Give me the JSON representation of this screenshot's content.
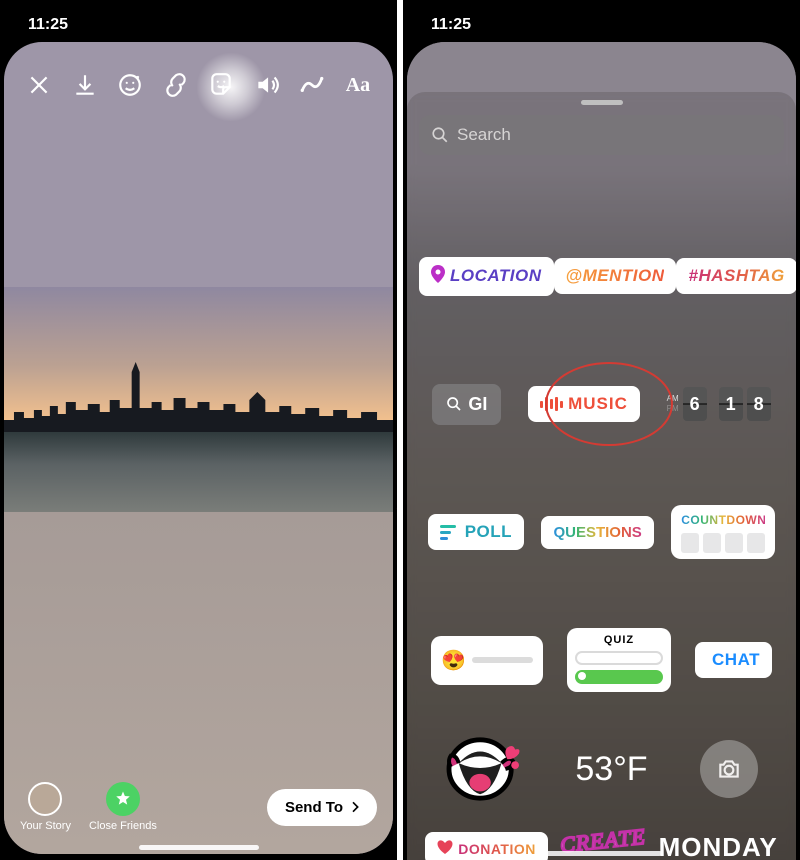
{
  "status": {
    "time": "11:25"
  },
  "left": {
    "share": {
      "your_story": "Your Story",
      "close_friends": "Close Friends",
      "send_to": "Send To"
    }
  },
  "right": {
    "search_placeholder": "Search",
    "stickers": {
      "location": "LOCATION",
      "mention": "@MENTION",
      "hashtag": "#HASHTAG",
      "gif": "GI",
      "music": "MUSIC",
      "clock": {
        "am": "AM",
        "pm": "PM",
        "d1": "6",
        "d2": "1",
        "d3": "8"
      },
      "poll": "POLL",
      "questions": "QUESTIONS",
      "countdown": "COUNTDOWN",
      "emoji": "😍",
      "quiz": "QUIZ",
      "chat": "CHAT",
      "temperature": "53°F",
      "donation": "DONATION",
      "create": "CREATE",
      "day": "MONDAY"
    }
  }
}
